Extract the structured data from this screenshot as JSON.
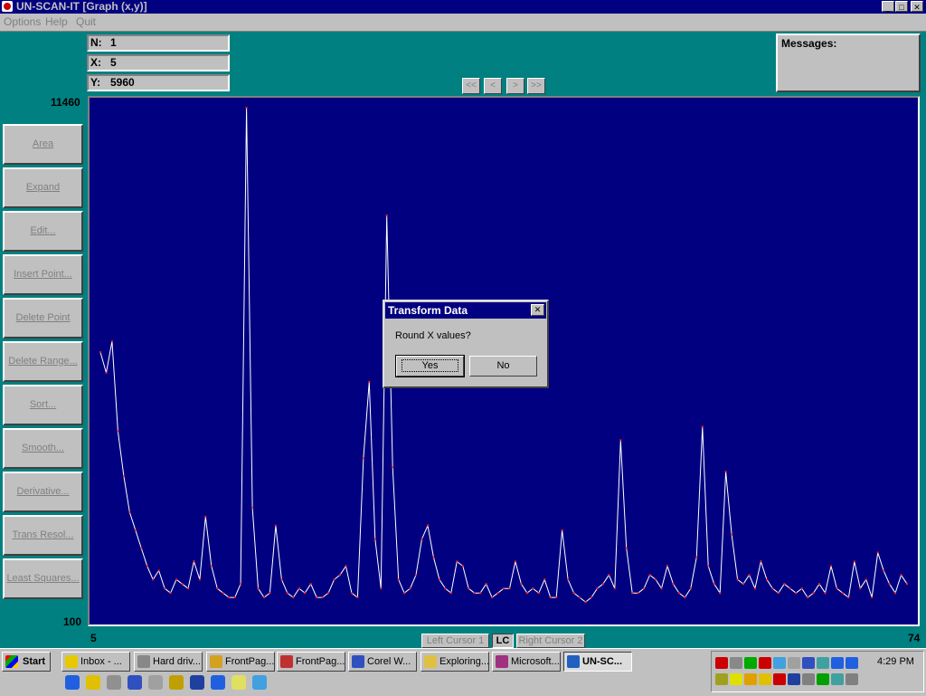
{
  "window": {
    "title": "UN-SCAN-IT [Graph (x,y)]"
  },
  "menu": [
    "Options",
    "Help",
    "Quit"
  ],
  "readouts": [
    {
      "label": "N:",
      "value": "1"
    },
    {
      "label": "X:",
      "value": "5"
    },
    {
      "label": "Y:",
      "value": "5960"
    }
  ],
  "messages": {
    "label": "Messages:"
  },
  "nav_buttons": [
    "<<",
    "<",
    ">",
    ">>"
  ],
  "side_buttons": [
    "Area",
    "Expand",
    "Edit...",
    "Insert Point...",
    "Delete Point",
    "Delete Range...",
    "Sort...",
    "Smooth...",
    "Derivative...",
    "Trans Resol...",
    "Least Squares..."
  ],
  "graph": {
    "y_max_label": "11460",
    "y_min_label": "100",
    "x_min_label": "5",
    "x_max_label": "74",
    "colors": {
      "background": "#000080",
      "trace": "#ffffff",
      "points": "#ff2020"
    }
  },
  "chart_data": {
    "type": "line",
    "title": "",
    "xlabel": "",
    "ylabel": "",
    "xlim": [
      5,
      74
    ],
    "ylim": [
      100,
      11460
    ],
    "x": [
      5,
      5.5,
      6,
      6.5,
      7,
      7.5,
      8,
      8.5,
      9,
      9.5,
      10,
      10.5,
      11,
      11.5,
      12,
      12.5,
      13,
      13.5,
      14,
      14.5,
      15,
      15.5,
      16,
      16.5,
      17,
      17.5,
      18,
      18.5,
      19,
      19.5,
      20,
      20.5,
      21,
      21.5,
      22,
      22.5,
      23,
      23.5,
      24,
      24.5,
      25,
      25.5,
      26,
      26.5,
      27,
      27.5,
      28,
      28.5,
      29,
      29.5,
      30,
      30.5,
      31,
      31.5,
      32,
      32.5,
      33,
      33.5,
      34,
      34.5,
      35,
      35.5,
      36,
      36.5,
      37,
      37.5,
      38,
      38.5,
      39,
      39.5,
      40,
      40.5,
      41,
      41.5,
      42,
      42.5,
      43,
      43.5,
      44,
      44.5,
      45,
      45.5,
      46,
      46.5,
      47,
      47.5,
      48,
      48.5,
      49,
      49.5,
      50,
      50.5,
      51,
      51.5,
      52,
      52.5,
      53,
      53.5,
      54,
      54.5,
      55,
      55.5,
      56,
      56.5,
      57,
      57.5,
      58,
      58.5,
      59,
      59.5,
      60,
      60.5,
      61,
      61.5,
      62,
      62.5,
      63,
      63.5,
      64,
      64.5,
      65,
      65.5,
      66,
      66.5,
      67,
      67.5,
      68,
      68.5,
      69,
      69.5,
      70,
      70.5,
      71,
      71.5,
      72,
      72.5,
      73,
      73.5,
      74
    ],
    "series": [
      {
        "values": [
          5960,
          5500,
          6200,
          4200,
          3200,
          2400,
          2000,
          1600,
          1200,
          900,
          1100,
          700,
          600,
          900,
          800,
          700,
          1300,
          900,
          2300,
          1200,
          700,
          600,
          500,
          500,
          800,
          11400,
          2500,
          700,
          500,
          600,
          2100,
          900,
          600,
          500,
          700,
          600,
          800,
          500,
          500,
          600,
          900,
          1000,
          1200,
          600,
          500,
          3600,
          5300,
          1800,
          700,
          9000,
          3400,
          900,
          600,
          700,
          1000,
          1800,
          2100,
          1400,
          900,
          700,
          600,
          1300,
          1200,
          700,
          600,
          600,
          800,
          500,
          600,
          700,
          700,
          1300,
          800,
          600,
          700,
          600,
          900,
          500,
          500,
          2000,
          900,
          600,
          500,
          400,
          500,
          700,
          800,
          1000,
          700,
          4000,
          1600,
          600,
          600,
          700,
          1000,
          900,
          700,
          1200,
          800,
          600,
          500,
          700,
          1400,
          4300,
          1200,
          800,
          600,
          3300,
          1900,
          900,
          800,
          1000,
          700,
          1300,
          900,
          700,
          600,
          800,
          700,
          600,
          700,
          500,
          600,
          800,
          600,
          1200,
          700,
          600,
          500,
          1300,
          700,
          900,
          500,
          1500,
          1100,
          800,
          600,
          1000,
          800,
          1300,
          700
        ]
      }
    ]
  },
  "cursor_buttons": [
    "Left Cursor 1",
    "LC",
    "Right Cursor 2"
  ],
  "dialog": {
    "title": "Transform Data",
    "message": "Round X values?",
    "yes": "Yes",
    "no": "No"
  },
  "taskbar": {
    "start": "Start",
    "tasks": [
      "Inbox - ...",
      "Hard driv...",
      "FrontPag...",
      "FrontPag...",
      "Corel W...",
      "Exploring...",
      "Microsoft...",
      "UN-SC..."
    ],
    "clock": "4:29 PM"
  }
}
